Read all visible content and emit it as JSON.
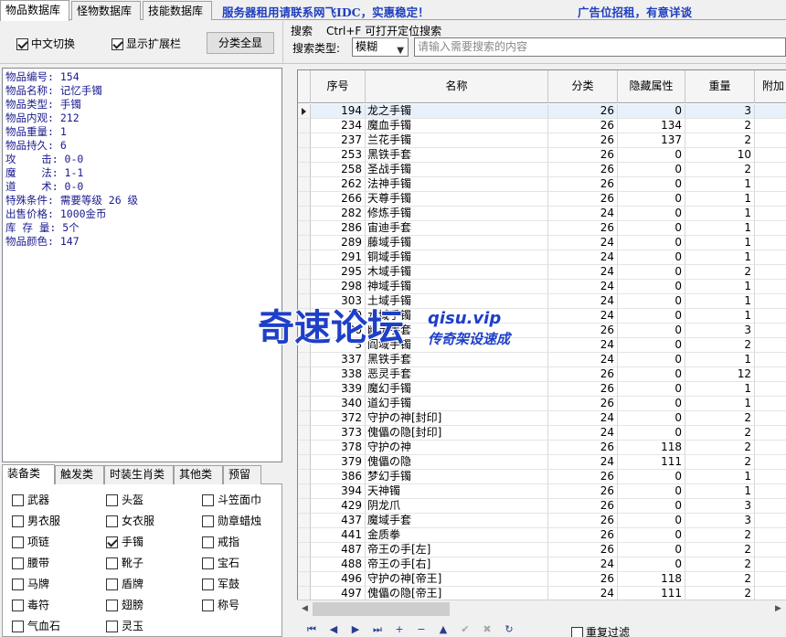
{
  "tabs": [
    "物品数据库",
    "怪物数据库",
    "技能数据库"
  ],
  "banner": {
    "left": "服务器租用请联系网飞IDC，实惠稳定！",
    "right": "广告位招租，有意详谈"
  },
  "options": {
    "chinese_toggle": "中文切换",
    "show_extension": "显示扩展栏",
    "show_all_button": "分类全显",
    "search_label": "搜索",
    "search_hint": "Ctrl+F 可打开定位搜索",
    "search_type_label": "搜索类型:",
    "search_type_value": "模糊",
    "search_placeholder": "请输入需要搜索的内容"
  },
  "info_lines": [
    "物品编号: 154",
    "物品名称: 记忆手镯",
    "物品类型: 手镯",
    "物品内观: 212",
    "物品重量: 1",
    "物品持久: 6",
    "攻    击: 0-0",
    "魔    法: 1-1",
    "道    术: 0-0",
    "特殊条件: 需要等级 26 级",
    "出售价格: 1000金币",
    "库 存 量: 5个",
    "物品颜色: 147"
  ],
  "category_tabs": [
    "装备类",
    "触发类",
    "时装生肖类",
    "其他类",
    "预留"
  ],
  "categories": [
    {
      "label": "武器",
      "checked": false
    },
    {
      "label": "头盔",
      "checked": false
    },
    {
      "label": "斗笠面巾",
      "checked": false
    },
    {
      "label": "男衣服",
      "checked": false
    },
    {
      "label": "女衣服",
      "checked": false
    },
    {
      "label": "勋章蜡烛",
      "checked": false
    },
    {
      "label": "项链",
      "checked": false
    },
    {
      "label": "手镯",
      "checked": true
    },
    {
      "label": "戒指",
      "checked": false
    },
    {
      "label": "腰带",
      "checked": false
    },
    {
      "label": "靴子",
      "checked": false
    },
    {
      "label": "宝石",
      "checked": false
    },
    {
      "label": "马牌",
      "checked": false
    },
    {
      "label": "盾牌",
      "checked": false
    },
    {
      "label": "军鼓",
      "checked": false
    },
    {
      "label": "毒符",
      "checked": false
    },
    {
      "label": "翅膀",
      "checked": false
    },
    {
      "label": "称号",
      "checked": false
    },
    {
      "label": "气血石",
      "checked": false
    },
    {
      "label": "灵玉",
      "checked": false
    }
  ],
  "grid": {
    "columns": [
      "序号",
      "名称",
      "分类",
      "隐藏属性",
      "重量",
      "附加"
    ],
    "rows": [
      [
        "194",
        "龙之手镯",
        "26",
        "0",
        "3"
      ],
      [
        "234",
        "魔血手镯",
        "26",
        "134",
        "2"
      ],
      [
        "237",
        "兰花手镯",
        "26",
        "137",
        "2"
      ],
      [
        "253",
        "黑铁手套",
        "26",
        "0",
        "10"
      ],
      [
        "258",
        "圣战手镯",
        "26",
        "0",
        "2"
      ],
      [
        "262",
        "法神手镯",
        "26",
        "0",
        "1"
      ],
      [
        "266",
        "天尊手镯",
        "26",
        "0",
        "1"
      ],
      [
        "282",
        "修炼手镯",
        "24",
        "0",
        "1"
      ],
      [
        "286",
        "宙迪手套",
        "26",
        "0",
        "1"
      ],
      [
        "289",
        "藤域手镯",
        "24",
        "0",
        "1"
      ],
      [
        "291",
        "铜域手镯",
        "24",
        "0",
        "1"
      ],
      [
        "295",
        "木域手镯",
        "24",
        "0",
        "2"
      ],
      [
        "298",
        "神域手镯",
        "24",
        "0",
        "1"
      ],
      [
        "303",
        "土域手镯",
        "24",
        "0",
        "1"
      ],
      [
        "30",
        "水域手镯",
        "24",
        "0",
        "1"
      ],
      [
        "30",
        "幽灵手套",
        "26",
        "0",
        "3"
      ],
      [
        "3",
        "阎域手镯",
        "24",
        "0",
        "2"
      ],
      [
        "337",
        "黑铁手套",
        "24",
        "0",
        "1"
      ],
      [
        "338",
        "恶灵手套",
        "26",
        "0",
        "12"
      ],
      [
        "339",
        "魔幻手镯",
        "26",
        "0",
        "1"
      ],
      [
        "340",
        "道幻手镯",
        "26",
        "0",
        "1"
      ],
      [
        "372",
        "守护の神[封印]",
        "24",
        "0",
        "2"
      ],
      [
        "373",
        "傀儡の隐[封印]",
        "24",
        "0",
        "2"
      ],
      [
        "378",
        "守护の神",
        "26",
        "118",
        "2"
      ],
      [
        "379",
        "傀儡の隐",
        "24",
        "111",
        "2"
      ],
      [
        "386",
        "梦幻手镯",
        "26",
        "0",
        "1"
      ],
      [
        "394",
        "天神镯",
        "26",
        "0",
        "1"
      ],
      [
        "429",
        "阴龙爪",
        "26",
        "0",
        "3"
      ],
      [
        "437",
        "魔域手套",
        "26",
        "0",
        "3"
      ],
      [
        "441",
        "金质拳",
        "26",
        "0",
        "2"
      ],
      [
        "487",
        "帝王の手[左]",
        "26",
        "0",
        "2"
      ],
      [
        "488",
        "帝王の手[右]",
        "24",
        "0",
        "2"
      ],
      [
        "496",
        "守护の神[帝王]",
        "26",
        "118",
        "2"
      ],
      [
        "497",
        "傀儡の隐[帝王]",
        "24",
        "111",
        "2"
      ]
    ]
  },
  "watermark": {
    "main": "奇速论坛",
    "url": "qisu.vip",
    "slogan": "传奇架设速成"
  },
  "bottom": {
    "reverse_filter": "重复过滤"
  }
}
